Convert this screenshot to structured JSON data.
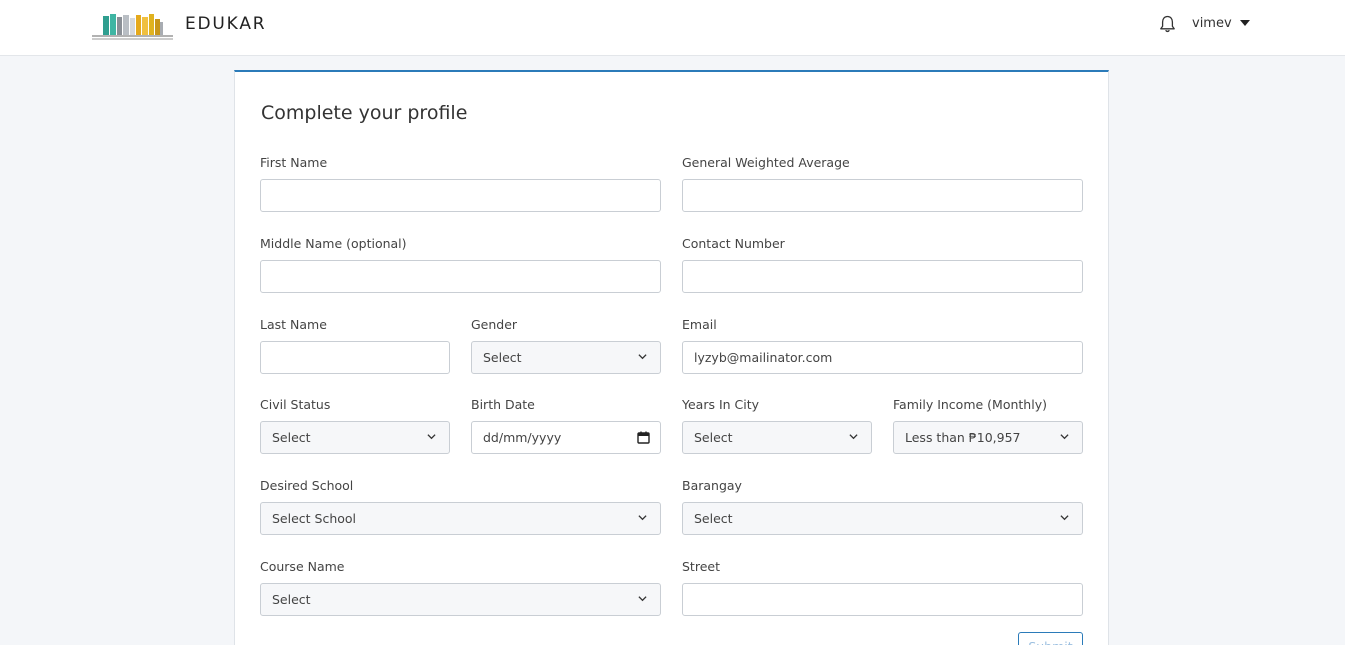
{
  "header": {
    "brand": "EDUKAR",
    "username": "vimev",
    "icons": {
      "bell": "bell-icon",
      "caret": "caret-down-icon"
    }
  },
  "form": {
    "title": "Complete your profile",
    "first_name": {
      "label": "First Name",
      "value": ""
    },
    "gwa": {
      "label": "General Weighted Average",
      "value": ""
    },
    "middle_name": {
      "label": "Middle Name (optional)",
      "value": ""
    },
    "contact_number": {
      "label": "Contact Number",
      "value": ""
    },
    "last_name": {
      "label": "Last Name",
      "value": ""
    },
    "gender": {
      "label": "Gender",
      "value": "Select"
    },
    "email": {
      "label": "Email",
      "value": "lyzyb@mailinator.com"
    },
    "civil_status": {
      "label": "Civil Status",
      "value": "Select"
    },
    "birth_date": {
      "label": "Birth Date",
      "value": "dd/mm/yyyy"
    },
    "years_in_city": {
      "label": "Years In City",
      "value": "Select"
    },
    "family_income": {
      "label": "Family Income (Monthly)",
      "value": "Less than ₱10,957"
    },
    "desired_school": {
      "label": "Desired School",
      "value": "Select School"
    },
    "barangay": {
      "label": "Barangay",
      "value": "Select"
    },
    "course_name": {
      "label": "Course Name",
      "value": "Select"
    },
    "street": {
      "label": "Street",
      "value": ""
    },
    "submit_label": "Submit"
  },
  "colors": {
    "accent": "#2b7bb9",
    "background": "#f4f6f9"
  }
}
